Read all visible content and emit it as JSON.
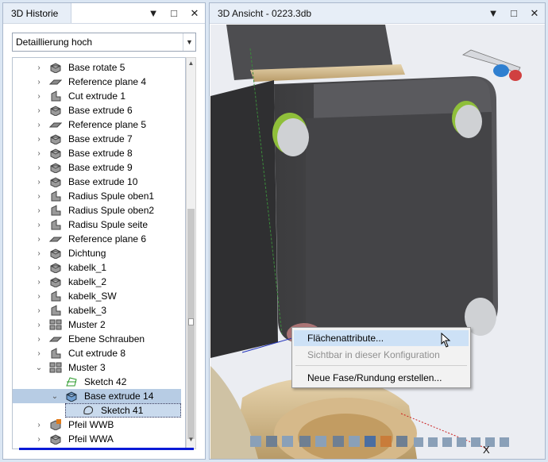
{
  "history_panel": {
    "title": "3D Historie",
    "controls": [
      "▼",
      "□",
      "✕"
    ],
    "detail_select": "Detaillierung hoch",
    "tree": [
      {
        "label": "Base rotate 5",
        "icon": "solid"
      },
      {
        "label": "Reference plane 4",
        "icon": "plane"
      },
      {
        "label": "Cut extrude 1",
        "icon": "cut"
      },
      {
        "label": "Base extrude 6",
        "icon": "solid"
      },
      {
        "label": "Reference plane 5",
        "icon": "plane"
      },
      {
        "label": "Base extrude 7",
        "icon": "solid"
      },
      {
        "label": "Base extrude 8",
        "icon": "solid"
      },
      {
        "label": "Base extrude 9",
        "icon": "solid"
      },
      {
        "label": "Base extrude 10",
        "icon": "solid"
      },
      {
        "label": "Radius Spule oben1",
        "icon": "cut"
      },
      {
        "label": "Radius Spule oben2",
        "icon": "cut"
      },
      {
        "label": "Radisu Spule seite",
        "icon": "cut"
      },
      {
        "label": "Reference plane 6",
        "icon": "plane"
      },
      {
        "label": "Dichtung",
        "icon": "solid"
      },
      {
        "label": "kabelk_1",
        "icon": "solid"
      },
      {
        "label": "kabelk_2",
        "icon": "solid"
      },
      {
        "label": "kabelk_SW",
        "icon": "cut"
      },
      {
        "label": "kabelk_3",
        "icon": "cut"
      },
      {
        "label": "Muster 2",
        "icon": "pattern"
      },
      {
        "label": "Ebene Schrauben",
        "icon": "plane"
      },
      {
        "label": "Cut extrude 8",
        "icon": "cut"
      },
      {
        "label": "Muster 3",
        "icon": "pattern"
      },
      {
        "label": "Sketch 42",
        "icon": "sketch"
      },
      {
        "label": "Base extrude 14",
        "icon": "solid-blue"
      },
      {
        "label": "Sketch 41",
        "icon": "sketch-outline"
      },
      {
        "label": "Pfeil WWB",
        "icon": "solid-orange"
      },
      {
        "label": "Pfeil WWA",
        "icon": "solid"
      }
    ]
  },
  "view_panel": {
    "title": "3D Ansicht - 0223.3db",
    "controls": [
      "▼",
      "□",
      "✕"
    ],
    "axis_label": "X"
  },
  "context_menu": {
    "items": [
      {
        "label": "Flächenattribute...",
        "state": "highlighted"
      },
      {
        "label": "Sichtbar in dieser Konfiguration",
        "state": "disabled"
      },
      {
        "label": "Neue Fase/Rundung erstellen...",
        "state": "normal"
      }
    ]
  },
  "colors": {
    "accent_blue": "#0a1ad6",
    "selection": "#b7cce4",
    "model_body": "#4a4a4c",
    "model_tan": "#d9c49a"
  }
}
